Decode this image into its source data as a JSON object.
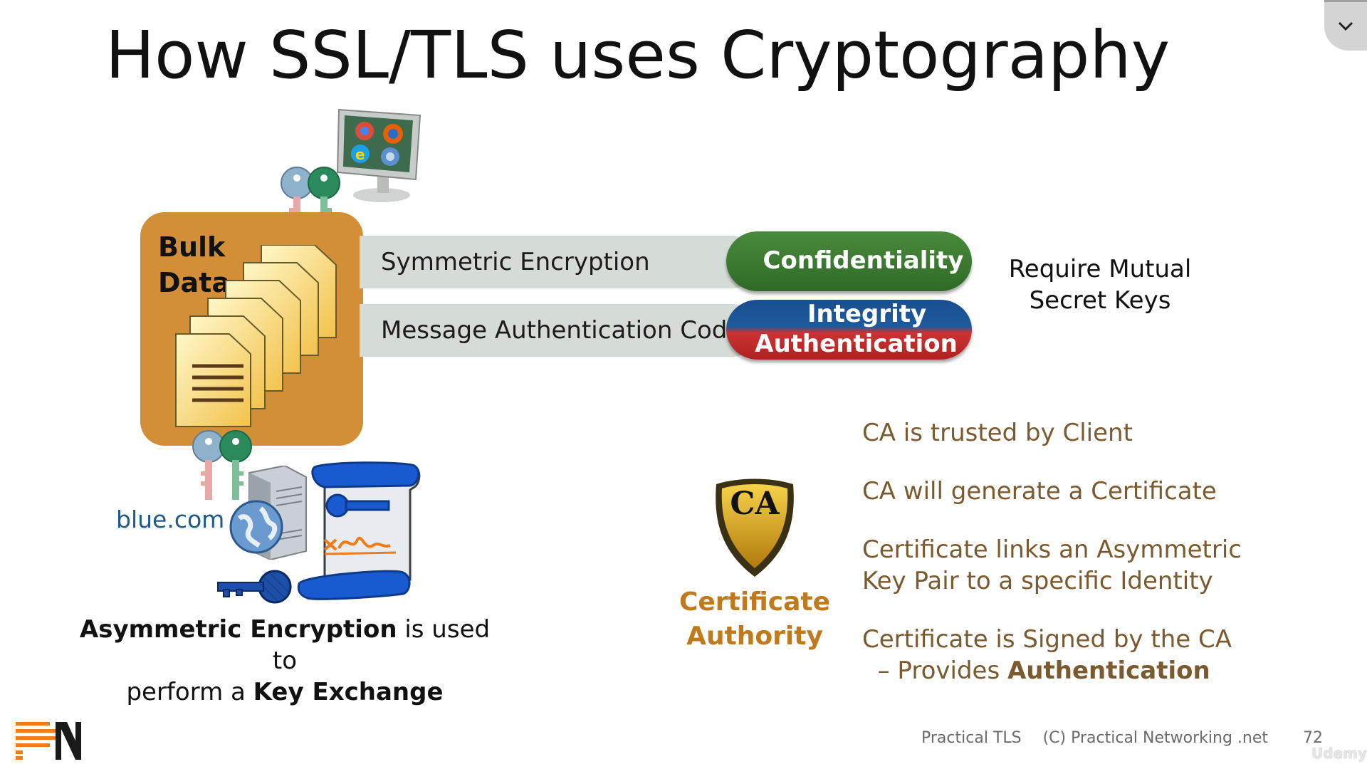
{
  "title": "How SSL/TLS uses Cryptography",
  "bulk": {
    "line1": "Bulk",
    "line2": "Data"
  },
  "symmetric": {
    "label": "Symmetric Encryption",
    "result": "Confidentiality"
  },
  "mac": {
    "label": "Message Authentication Code",
    "result1": "Integrity",
    "result2": "Authentication"
  },
  "mutual_keys": {
    "line1": "Require Mutual",
    "line2": "Secret Keys"
  },
  "server_domain": "blue.com",
  "asymmetric_caption": {
    "bold1": "Asymmetric Encryption",
    "text1": " is used to",
    "text2": "perform a ",
    "bold2": "Key Exchange"
  },
  "ca_badge": "CA",
  "ca_caption": {
    "line1": "Certificate",
    "line2": "Authority"
  },
  "ca_points": {
    "p1": "CA is trusted by Client",
    "p2": "CA will generate a Certificate",
    "p3a": "Certificate links an Asymmetric",
    "p3b": "Key Pair to a specific Identity",
    "p4a": "Certificate is Signed by the CA",
    "p4b": "– Provides ",
    "p4bold": "Authentication"
  },
  "footer": {
    "course": "Practical TLS",
    "copyright": "(C) Practical Networking .net",
    "page": "72",
    "watermark": "Udemy"
  },
  "colors": {
    "bulk_box": "#d38f38",
    "confidentiality": "#2e6a26",
    "integrity": "#1a4d8f",
    "authentication": "#b02020",
    "ca_text": "#7a5a2e",
    "ca_caption": "#c07a1c",
    "domain": "#1f5a8c"
  },
  "icons": [
    "chevron-down-icon",
    "browser-monitor-icon",
    "symmetric-key-pair-icon",
    "documents-stack-icon",
    "server-icon",
    "globe-icon",
    "certificate-scroll-icon",
    "public-key-icon",
    "ca-shield-icon",
    "pn-logo"
  ]
}
